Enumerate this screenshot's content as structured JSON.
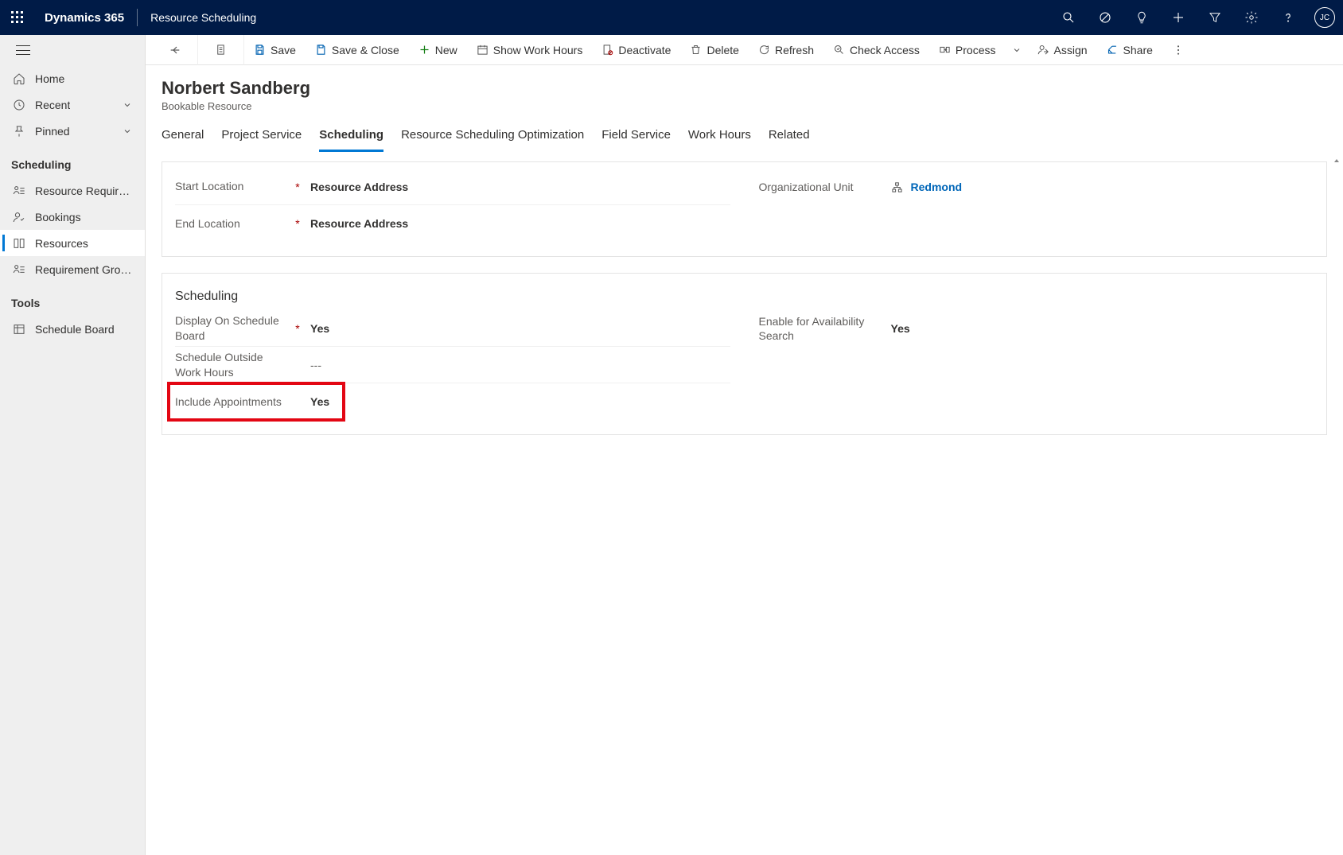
{
  "topbar": {
    "brand": "Dynamics 365",
    "appname": "Resource Scheduling",
    "avatar_initials": "JC"
  },
  "sidebar": {
    "home": "Home",
    "recent": "Recent",
    "pinned": "Pinned",
    "section_scheduling": "Scheduling",
    "items": [
      "Resource Requireme…",
      "Bookings",
      "Resources",
      "Requirement Groups"
    ],
    "section_tools": "Tools",
    "tools": [
      "Schedule Board"
    ]
  },
  "commands": {
    "save": "Save",
    "save_close": "Save & Close",
    "new": "New",
    "show_work_hours": "Show Work Hours",
    "deactivate": "Deactivate",
    "delete": "Delete",
    "refresh": "Refresh",
    "check_access": "Check Access",
    "process": "Process",
    "assign": "Assign",
    "share": "Share"
  },
  "record": {
    "title": "Norbert Sandberg",
    "subtitle": "Bookable Resource"
  },
  "tabs": [
    "General",
    "Project Service",
    "Scheduling",
    "Resource Scheduling Optimization",
    "Field Service",
    "Work Hours",
    "Related"
  ],
  "active_tab_index": 2,
  "section1": {
    "start_location_label": "Start Location",
    "start_location_value": "Resource Address",
    "end_location_label": "End Location",
    "end_location_value": "Resource Address",
    "org_unit_label": "Organizational Unit",
    "org_unit_value": "Redmond"
  },
  "section2": {
    "title": "Scheduling",
    "display_board_label": "Display On Schedule Board",
    "display_board_value": "Yes",
    "enable_avail_label": "Enable for Availability Search",
    "enable_avail_value": "Yes",
    "sched_outside_label": "Schedule Outside Work Hours",
    "sched_outside_value": "---",
    "include_appt_label": "Include Appointments",
    "include_appt_value": "Yes"
  }
}
